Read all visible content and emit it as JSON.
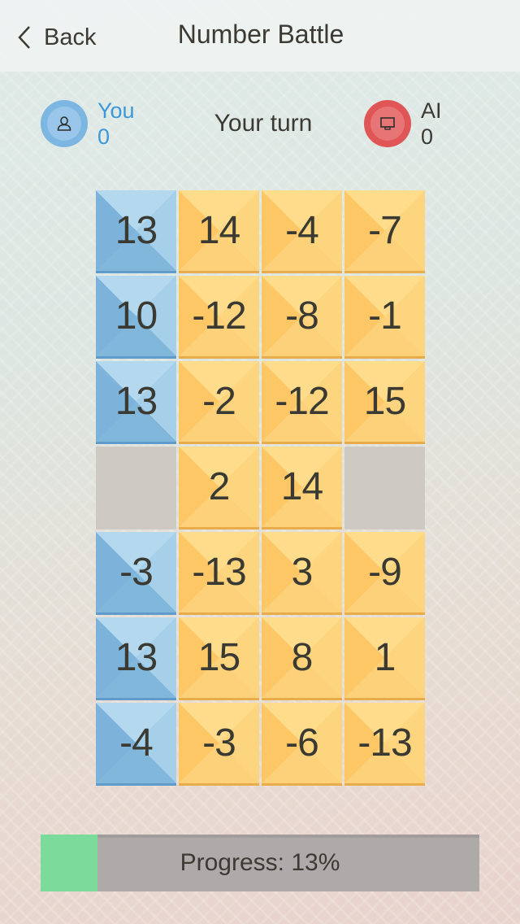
{
  "navbar": {
    "back_label": "Back",
    "title": "Number Battle"
  },
  "players": {
    "you": {
      "name": "You",
      "score": "0",
      "icon": "user-icon",
      "color": "#7db6e1"
    },
    "ai": {
      "name": "AI",
      "score": "0",
      "icon": "monitor-icon",
      "color": "#e05555"
    }
  },
  "status": {
    "turn_text": "Your turn"
  },
  "board": {
    "columns": 4,
    "rows": [
      [
        {
          "value": "13",
          "state": "blue"
        },
        {
          "value": "14",
          "state": "yellow"
        },
        {
          "value": "-4",
          "state": "yellow"
        },
        {
          "value": "-7",
          "state": "yellow"
        }
      ],
      [
        {
          "value": "10",
          "state": "blue"
        },
        {
          "value": "-12",
          "state": "yellow"
        },
        {
          "value": "-8",
          "state": "yellow"
        },
        {
          "value": "-1",
          "state": "yellow"
        }
      ],
      [
        {
          "value": "13",
          "state": "blue"
        },
        {
          "value": "-2",
          "state": "yellow"
        },
        {
          "value": "-12",
          "state": "yellow"
        },
        {
          "value": "15",
          "state": "yellow"
        }
      ],
      [
        {
          "value": "",
          "state": "empty"
        },
        {
          "value": "2",
          "state": "yellow"
        },
        {
          "value": "14",
          "state": "yellow"
        },
        {
          "value": "",
          "state": "empty"
        }
      ],
      [
        {
          "value": "-3",
          "state": "blue"
        },
        {
          "value": "-13",
          "state": "yellow"
        },
        {
          "value": "3",
          "state": "yellow"
        },
        {
          "value": "-9",
          "state": "yellow"
        }
      ],
      [
        {
          "value": "13",
          "state": "blue"
        },
        {
          "value": "15",
          "state": "yellow"
        },
        {
          "value": "8",
          "state": "yellow"
        },
        {
          "value": "1",
          "state": "yellow"
        }
      ],
      [
        {
          "value": "-4",
          "state": "blue"
        },
        {
          "value": "-3",
          "state": "yellow"
        },
        {
          "value": "-6",
          "state": "yellow"
        },
        {
          "value": "-13",
          "state": "yellow"
        }
      ]
    ]
  },
  "progress": {
    "label": "Progress: 13%",
    "percent": 13,
    "fill_color": "#7bdb9a"
  }
}
